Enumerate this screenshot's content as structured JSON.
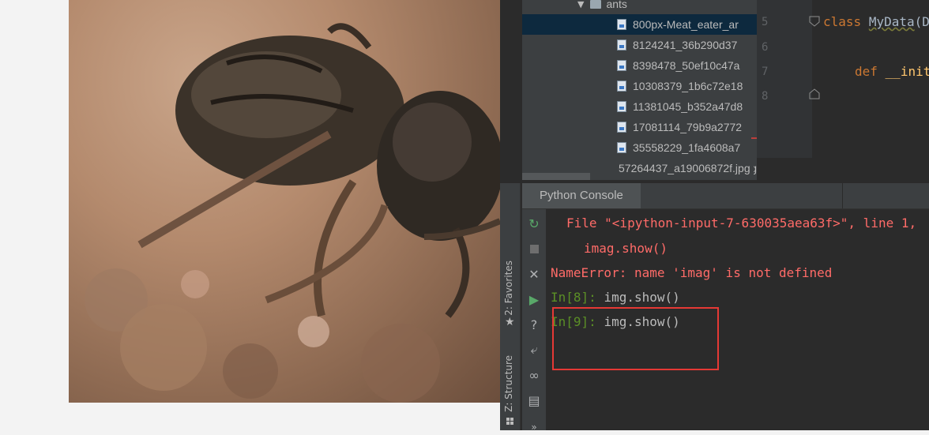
{
  "viewer": {
    "image_name": "ant-photo"
  },
  "strip": {
    "favorites_label": "2: Favorites",
    "structure_label": "Z: Structure"
  },
  "tree": {
    "folder_name": "ants",
    "files": [
      "800px-Meat_eater_ar",
      "8124241_36b290d37",
      "8398478_50ef10c47a",
      "10308379_1b6c72e18",
      "11381045_b352a47d8",
      "17081114_79b9a2772",
      "35558229_1fa4608a7",
      "57264437_a19006872f.jpg"
    ]
  },
  "editor": {
    "line_numbers": [
      "5",
      "6",
      "7",
      "8"
    ],
    "line5_kw": "class",
    "line5_name": "MyData",
    "line5_rest": "(D",
    "line7_kw": "def",
    "line7_fn": "__init"
  },
  "console": {
    "tab_label": "Python Console",
    "lines": {
      "file_line": "File \"<ipython-input-7-630035aea63f>\", line 1,",
      "code_line": "imag.show()",
      "error_line": "NameError: name 'imag' is not defined",
      "in8_prompt": "In[8]:",
      "in8_cmd": "img.show()",
      "in9_prompt": "In[9]:",
      "in9_cmd": "img.show()"
    }
  },
  "colors": {
    "error": "#ff6b68",
    "prompt": "#5b8f26",
    "highlight": "#e53935",
    "selection": "#0d293e"
  }
}
